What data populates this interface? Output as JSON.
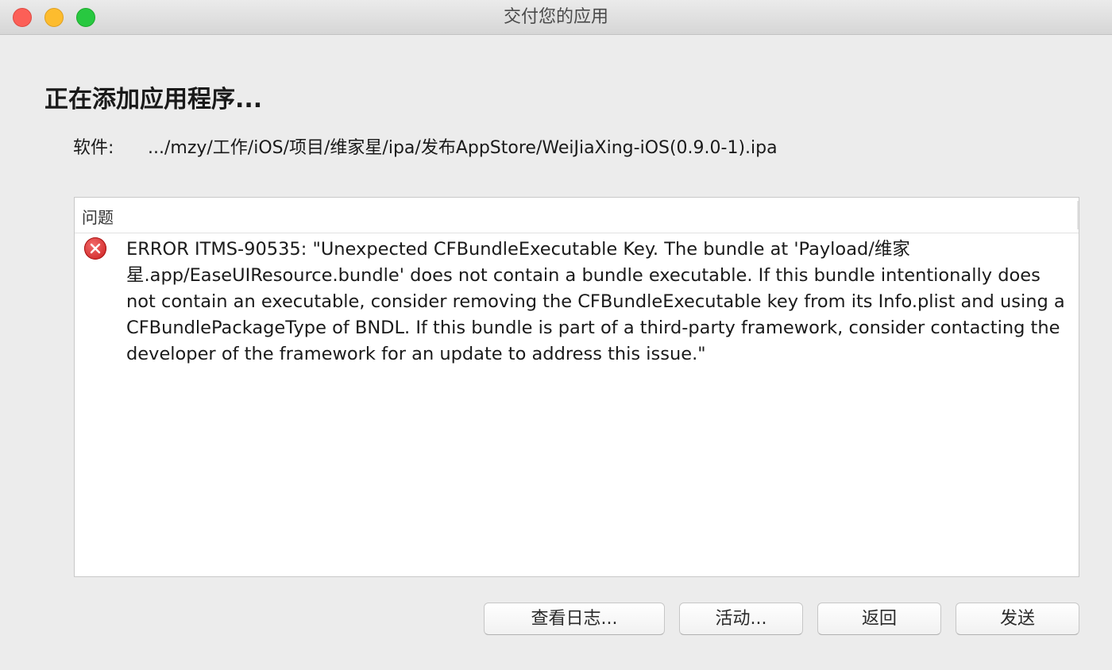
{
  "window": {
    "title": "交付您的应用"
  },
  "main": {
    "heading": "正在添加应用程序...",
    "software_label": "软件:",
    "software_path": ".../mzy/工作/iOS/项目/维家星/ipa/发布AppStore/WeiJiaXing-iOS(0.9.0-1).ipa"
  },
  "issues": {
    "header": "问题",
    "items": [
      {
        "severity_icon": "error-icon",
        "text": "ERROR ITMS-90535: \"Unexpected CFBundleExecutable Key. The bundle at 'Payload/维家星.app/EaseUIResource.bundle' does not contain a bundle executable. If this bundle intentionally does not contain an executable, consider removing the CFBundleExecutable key from its Info.plist and using a CFBundlePackageType of BNDL. If this bundle is part of a third-party framework, consider contacting the developer of the framework for an update to address this issue.\""
      }
    ]
  },
  "buttons": {
    "view_log": "查看日志...",
    "activity": "活动...",
    "back": "返回",
    "send": "发送"
  },
  "colors": {
    "traffic_close": "#fc5f57",
    "traffic_minimize": "#fdbc2e",
    "traffic_zoom": "#28c840",
    "error": "#d62a2a",
    "window_bg": "#ececec"
  }
}
